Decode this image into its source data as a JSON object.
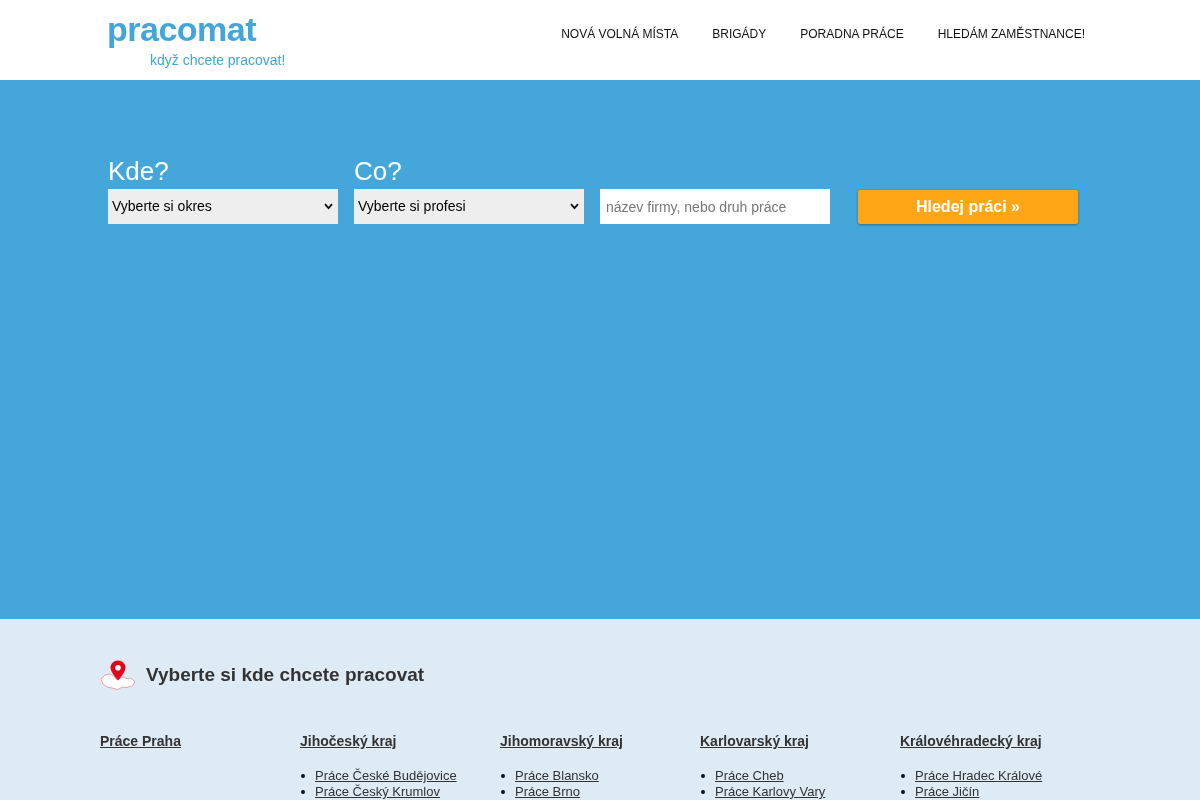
{
  "logo": {
    "name": "pracomat",
    "tagline": "když chcete pracovat!"
  },
  "nav": [
    {
      "label": "NOVÁ VOLNÁ MÍSTA"
    },
    {
      "label": "BRIGÁDY"
    },
    {
      "label": "PORADNA PRÁCE"
    },
    {
      "label": "HLEDÁM ZAMĚSTNANCE!"
    }
  ],
  "search": {
    "fields": [
      {
        "kind": "select",
        "label": "Kde?",
        "value": "Vyberte si okres"
      },
      {
        "kind": "select",
        "label": "Co?",
        "value": "Vyberte si profesi"
      },
      {
        "kind": "input",
        "placeholder": "název firmy, nebo druh práce"
      }
    ],
    "button": "Hledej práci »"
  },
  "regions": {
    "title": "Vyberte si kde chcete pracovat",
    "columns": [
      {
        "heading": "Práce Praha"
      },
      {
        "heading": "Jihočeský kraj",
        "links": [
          "Práce České Budějovice",
          "Práce Český Krumlov"
        ]
      },
      {
        "heading": "Jihomoravský kraj",
        "links": [
          "Práce Blansko",
          "Práce Brno"
        ]
      },
      {
        "heading": "Karlovarský kraj",
        "links": [
          "Práce Cheb",
          "Práce Karlovy Vary"
        ]
      },
      {
        "heading": "Královéhradecký kraj",
        "links": [
          "Práce Hradec Králové",
          "Práce Jičín"
        ]
      }
    ]
  }
}
